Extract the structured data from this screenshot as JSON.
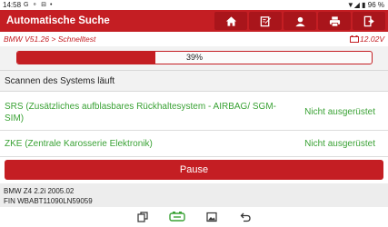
{
  "status_bar": {
    "time": "14:58",
    "icons": "G ⚬ ⊟ •",
    "battery": "▼◢ ▮ 96 %"
  },
  "header": {
    "title": "Automatische Suche"
  },
  "toolbar": {
    "buttons": [
      {
        "icon": "home-icon"
      },
      {
        "icon": "edit-icon"
      },
      {
        "icon": "user-icon"
      },
      {
        "icon": "print-icon"
      },
      {
        "icon": "exit-icon"
      }
    ]
  },
  "breadcrumb": {
    "path": "BMW V51.26 > Schnelltest",
    "voltage": "12.02V"
  },
  "progress": {
    "value": 0.39,
    "label": "39%"
  },
  "scan": {
    "status": "Scannen des Systems läuft"
  },
  "systems": [
    {
      "name": "SRS (Zusätzliches aufblasbares Rückhaltesystem - AIRBAG/ SGM-SIM)",
      "status": "Nicht ausgerüstet"
    },
    {
      "name": "ZKE (Zentrale Karosserie Elektronik)",
      "status": "Nicht ausgerüstet"
    }
  ],
  "actions": {
    "pause": "Pause"
  },
  "vehicle": {
    "model": "BMW Z4 2.2i 2005.02",
    "fin": "FIN WBABT11090LN59059"
  },
  "colors": {
    "accent": "#c41e23",
    "ok": "#3aa235"
  }
}
